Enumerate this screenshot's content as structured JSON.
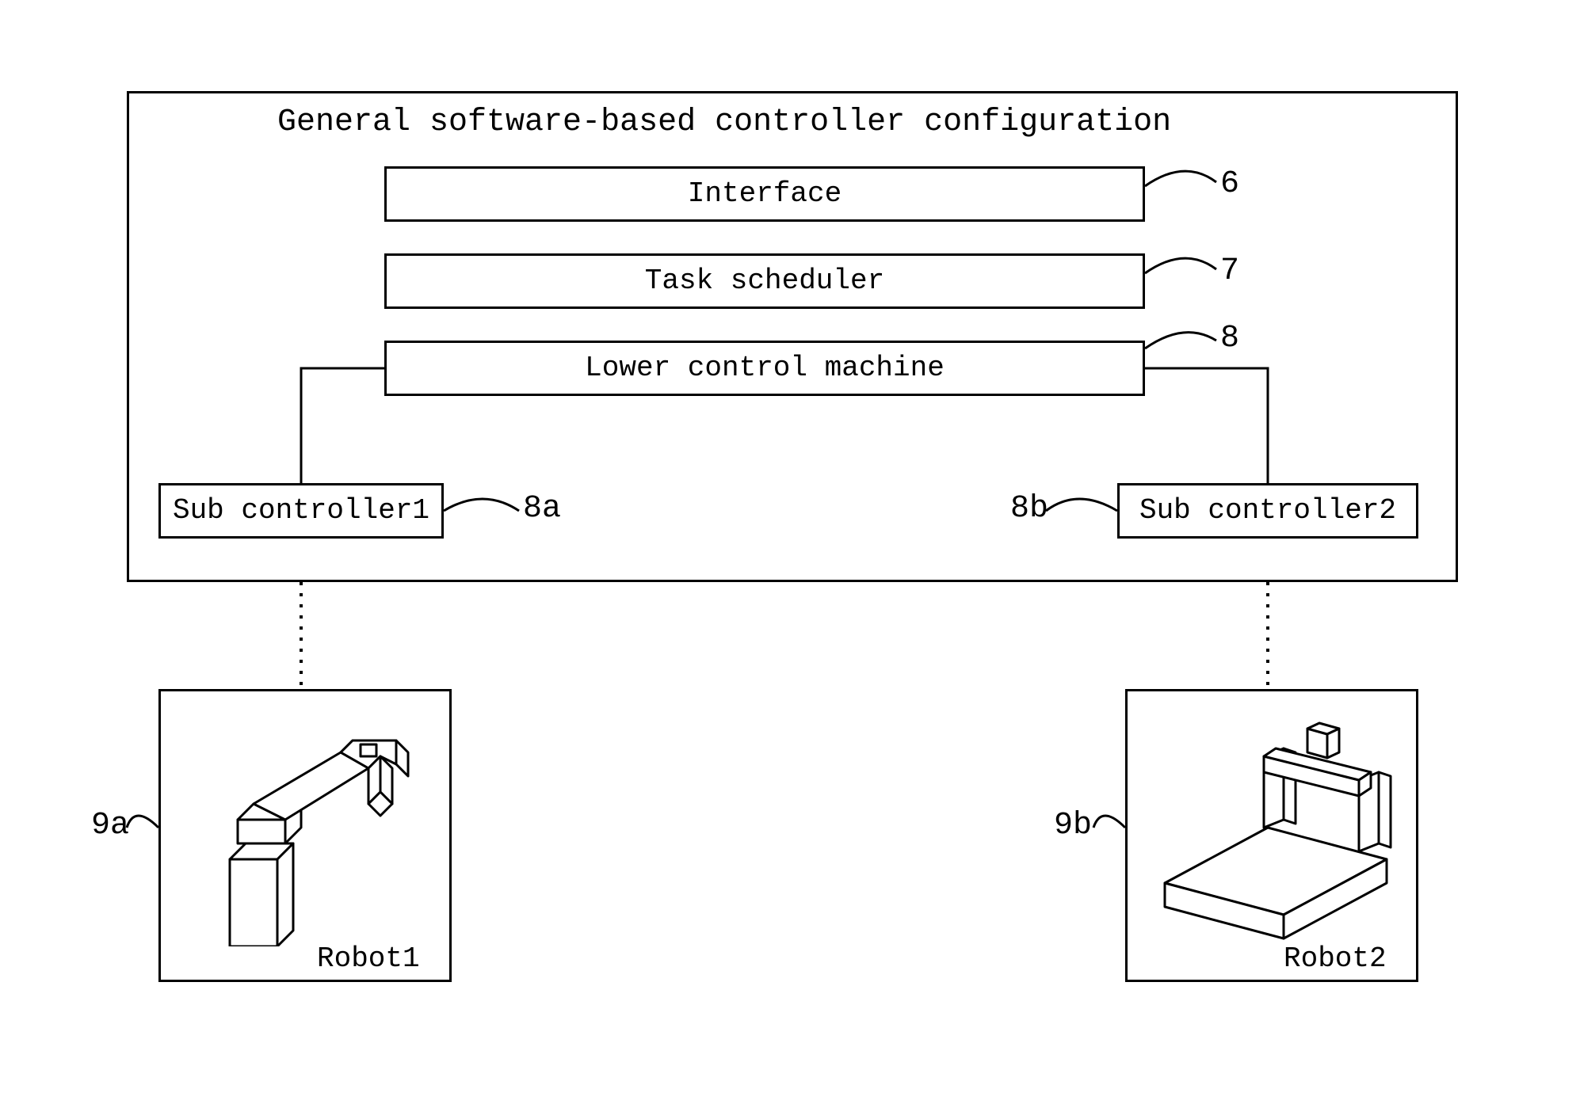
{
  "diagram": {
    "title": "General software-based controller configuration",
    "blocks": {
      "interface": "Interface",
      "task_scheduler": "Task scheduler",
      "lower_control": "Lower control machine",
      "sub1": "Sub controller1",
      "sub2": "Sub controller2"
    },
    "robots": {
      "robot1": "Robot1",
      "robot2": "Robot2"
    },
    "refs": {
      "interface": "6",
      "task_scheduler": "7",
      "lower_control": "8",
      "sub1": "8a",
      "sub2": "8b",
      "robot1": "9a",
      "robot2": "9b"
    }
  }
}
